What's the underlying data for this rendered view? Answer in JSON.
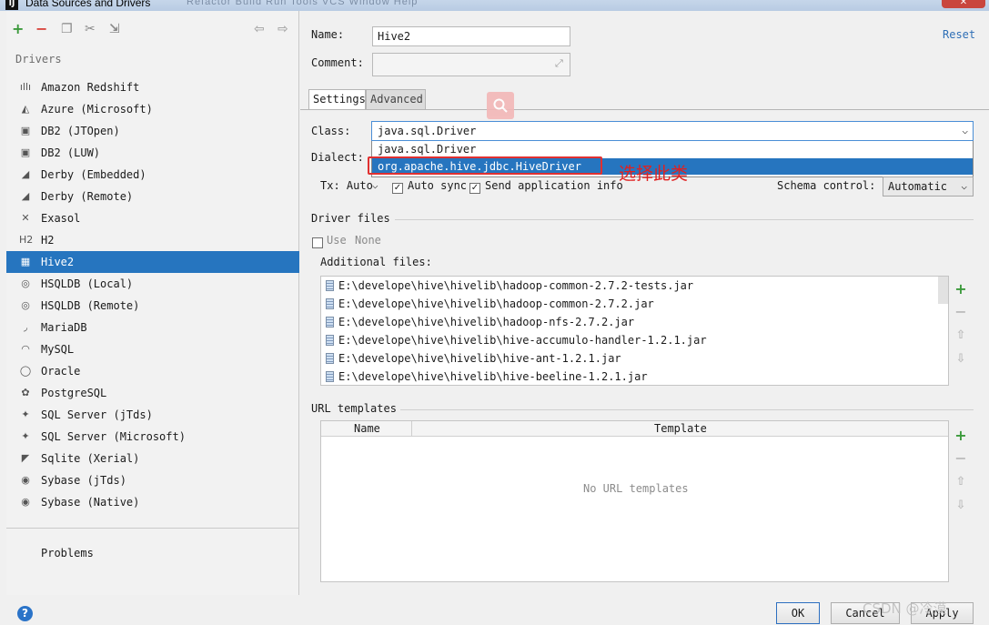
{
  "window": {
    "title": "Data Sources and Drivers",
    "app_icon": "IJ",
    "ghost_menu": "Refactor  Build  Run  Tools  VCS  Window  Help",
    "close_icon": "✕"
  },
  "toolbar": {
    "add_icon": "+",
    "remove_icon": "−",
    "copy_icon": "❐",
    "settings_icon": "✂",
    "import_icon": "⇲",
    "back_icon": "⇦",
    "forward_icon": "⇨"
  },
  "sidebar": {
    "header": "Drivers",
    "items": [
      {
        "label": "Amazon Redshift",
        "icon": "ıllı"
      },
      {
        "label": "Azure (Microsoft)",
        "icon": "◭"
      },
      {
        "label": "DB2 (JTOpen)",
        "icon": "▣"
      },
      {
        "label": "DB2 (LUW)",
        "icon": "▣"
      },
      {
        "label": "Derby (Embedded)",
        "icon": "◢"
      },
      {
        "label": "Derby (Remote)",
        "icon": "◢"
      },
      {
        "label": "Exasol",
        "icon": "✕"
      },
      {
        "label": "H2",
        "icon": "H2"
      },
      {
        "label": "Hive2",
        "icon": "▦"
      },
      {
        "label": "HSQLDB (Local)",
        "icon": "◎"
      },
      {
        "label": "HSQLDB (Remote)",
        "icon": "◎"
      },
      {
        "label": "MariaDB",
        "icon": "◞"
      },
      {
        "label": "MySQL",
        "icon": "◠"
      },
      {
        "label": "Oracle",
        "icon": "◯"
      },
      {
        "label": "PostgreSQL",
        "icon": "✿"
      },
      {
        "label": "SQL Server (jTds)",
        "icon": "✦"
      },
      {
        "label": "SQL Server (Microsoft)",
        "icon": "✦"
      },
      {
        "label": "Sqlite (Xerial)",
        "icon": "◤"
      },
      {
        "label": "Sybase (jTds)",
        "icon": "◉"
      },
      {
        "label": "Sybase (Native)",
        "icon": "◉"
      }
    ],
    "selected": "Hive2",
    "problems": "Problems"
  },
  "form": {
    "name_label": "Name:",
    "name_value": "Hive2",
    "comment_label": "Comment:",
    "comment_value": "",
    "expand_icon": "⤢",
    "reset": "Reset",
    "tabs": [
      "Settings",
      "Advanced"
    ],
    "active_tab": "Settings",
    "class_label": "Class:",
    "class_value": "java.sql.Driver",
    "class_options": [
      "java.sql.Driver",
      "org.apache.hive.jdbc.HiveDriver"
    ],
    "highlighted_option": "org.apache.hive.jdbc.HiveDriver",
    "dialect_label": "Dialect:",
    "tx_label": "Tx: Auto",
    "auto_sync_label": "Auto sync",
    "auto_sync_checked": true,
    "send_info_label": "Send application info",
    "send_info_checked": true,
    "schema_control_label": "Schema control:",
    "schema_control_value": "Automatic",
    "chevron_icon": "⌵",
    "annotation": "选择此类"
  },
  "driver_files": {
    "title": "Driver files",
    "use_label": "Use",
    "use_value": "None",
    "use_checked": false,
    "additional_label": "Additional files:",
    "files": [
      "E:\\develope\\hive\\hivelib\\hadoop-common-2.7.2-tests.jar",
      "E:\\develope\\hive\\hivelib\\hadoop-common-2.7.2.jar",
      "E:\\develope\\hive\\hivelib\\hadoop-nfs-2.7.2.jar",
      "E:\\develope\\hive\\hivelib\\hive-accumulo-handler-1.2.1.jar",
      "E:\\develope\\hive\\hivelib\\hive-ant-1.2.1.jar",
      "E:\\develope\\hive\\hivelib\\hive-beeline-1.2.1.jar"
    ],
    "buttons": {
      "add": "+",
      "remove": "−",
      "up": "⇧",
      "down": "⇩"
    }
  },
  "url_templates": {
    "title": "URL templates",
    "columns": [
      "Name",
      "Template"
    ],
    "empty_text": "No URL templates",
    "buttons": {
      "add": "+",
      "remove": "−",
      "up": "⇧",
      "down": "⇩"
    }
  },
  "footer": {
    "help_icon": "?",
    "ok": "OK",
    "cancel": "Cancel",
    "apply": "Apply",
    "watermark": "CSDN @冷漠"
  },
  "colors": {
    "selection": "#2675bf",
    "add_green": "#3c9a3c",
    "remove_red": "#d9463f",
    "link": "#2f6fb6",
    "annotation_red": "#e02020"
  }
}
